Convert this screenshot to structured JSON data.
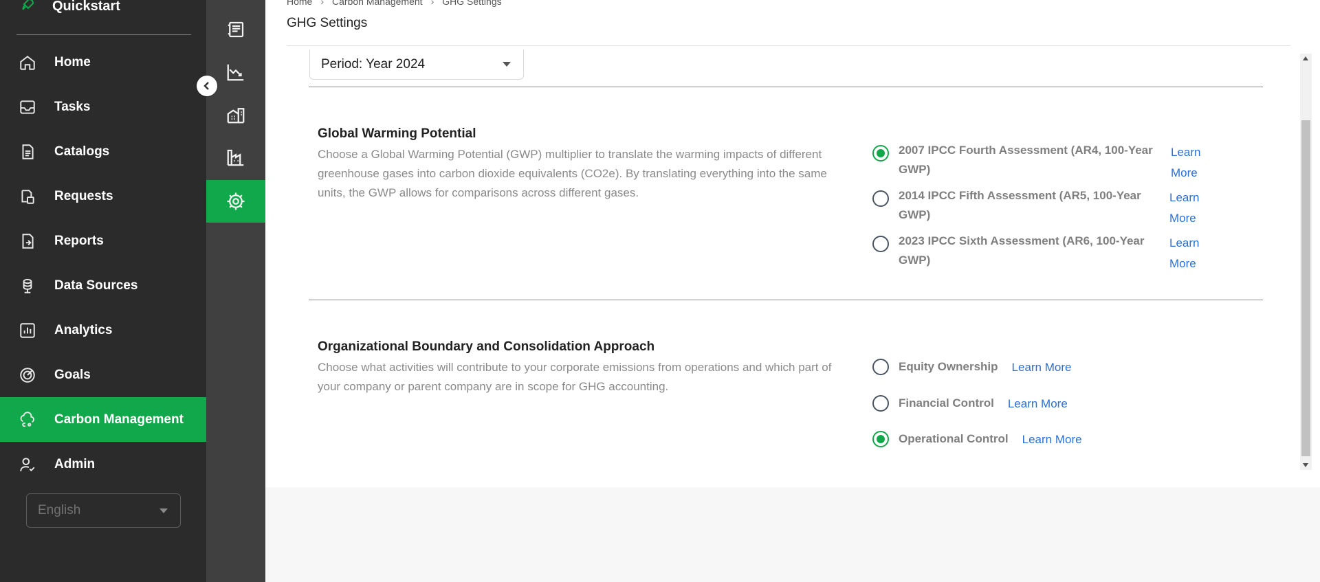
{
  "sidebar": {
    "quickstart_label": "Quickstart",
    "items": [
      {
        "label": "Home",
        "icon": "home-icon"
      },
      {
        "label": "Tasks",
        "icon": "inbox-icon"
      },
      {
        "label": "Catalogs",
        "icon": "catalog-icon"
      },
      {
        "label": "Requests",
        "icon": "requests-icon"
      },
      {
        "label": "Reports",
        "icon": "reports-icon"
      },
      {
        "label": "Data Sources",
        "icon": "database-icon"
      },
      {
        "label": "Analytics",
        "icon": "analytics-icon"
      },
      {
        "label": "Goals",
        "icon": "target-icon"
      },
      {
        "label": "Carbon Management",
        "icon": "cloud-co2-icon",
        "active": true
      },
      {
        "label": "Admin",
        "icon": "user-check-icon"
      }
    ],
    "language": "English"
  },
  "rail": {
    "items": [
      "ledger-icon",
      "chart-trend-icon",
      "buildings-icon",
      "factory-icon",
      "gear-icon"
    ],
    "active_index": 4
  },
  "header": {
    "breadcrumb": [
      "Home",
      "Carbon Management",
      "GHG Settings"
    ],
    "title": "GHG Settings"
  },
  "period": {
    "label": "Period: Year 2024"
  },
  "gwp": {
    "title": "Global Warming Potential",
    "description": "Choose a Global Warming Potential (GWP) multiplier to translate the warming impacts of different greenhouse gases into carbon dioxide equivalents (CO2e). By translating everything into the same units, the GWP allows for comparisons across different gases.",
    "options": [
      {
        "line1": "2007 IPCC Fourth Assessment (AR4, 100-Year",
        "line2": "GWP)",
        "learn1": "Learn",
        "learn2": "More",
        "checked": true
      },
      {
        "line1": "2014 IPCC Fifth Assessment (AR5, 100-Year",
        "line2": "GWP)",
        "learn1": "Learn",
        "learn2": "More",
        "checked": false
      },
      {
        "line1": "2023 IPCC Sixth Assessment (AR6, 100-Year",
        "line2": "GWP)",
        "learn1": "Learn",
        "learn2": "More",
        "checked": false
      }
    ]
  },
  "boundary": {
    "title": "Organizational Boundary and Consolidation Approach",
    "description": "Choose what activities will contribute to your corporate emissions from operations and which part of your company or parent company are in scope for GHG accounting.",
    "options": [
      {
        "label": "Equity Ownership",
        "learn": "Learn More",
        "checked": false
      },
      {
        "label": "Financial Control",
        "learn": "Learn More",
        "checked": false
      },
      {
        "label": "Operational Control",
        "learn": "Learn More",
        "checked": true
      }
    ]
  },
  "colors": {
    "accent": "#10a84a",
    "sidebar_bg": "#2b2b2b",
    "rail_bg": "#404040",
    "link": "#2a6fd6"
  }
}
